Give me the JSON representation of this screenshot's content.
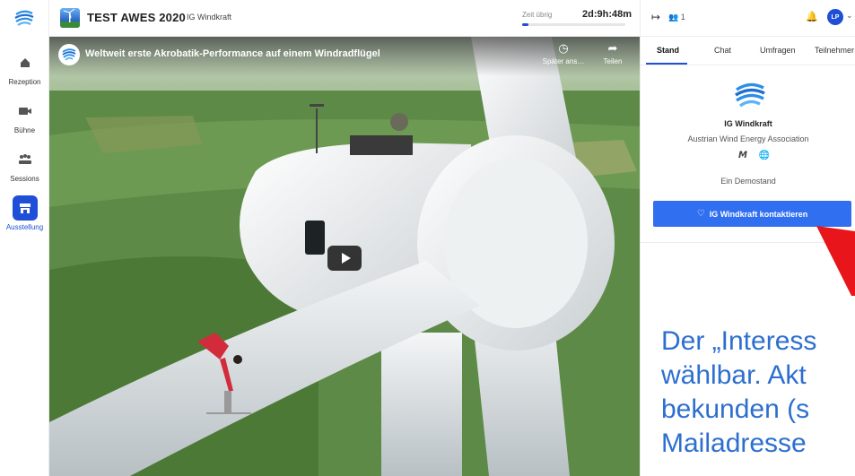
{
  "sidebar": {
    "items": [
      {
        "label": "Rezeption",
        "icon": "home-icon"
      },
      {
        "label": "Bühne",
        "icon": "camera-icon"
      },
      {
        "label": "Sessions",
        "icon": "group-icon"
      },
      {
        "label": "Ausstellung",
        "icon": "booth-icon",
        "active": true
      }
    ]
  },
  "header": {
    "event_title": "TEST AWES 2020",
    "event_subtitle": "IG Windkraft",
    "timer_label": "Zeit übrig",
    "timer_value": "2d:9h:48m",
    "timer_progress": 0.06
  },
  "video": {
    "title": "Weltweit erste Akrobatik-Performance auf einem Windradflügel",
    "watch_later_label": "Später ans…",
    "share_label": "Teilen",
    "source_text": ""
  },
  "panel": {
    "attendee_count": "1",
    "avatar_initials": "LP",
    "tabs": [
      "Stand",
      "Chat",
      "Umfragen",
      "Teilnehmer"
    ],
    "active_tab": "Stand",
    "stand_name": "IG Windkraft",
    "stand_description": "Austrian Wind Energy Association",
    "stand_note": "Ein Demostand",
    "contact_button_label": "IG Windkraft kontaktieren"
  },
  "overlay": {
    "lines": [
      "Der „Interess",
      "wählbar. Akt",
      "bekunden (s",
      "Mailadresse"
    ]
  },
  "colors": {
    "accent": "#1f4fd6",
    "button": "#2f6ff0",
    "overlay_text": "#2d6fcf",
    "arrow": "#e8151b"
  }
}
